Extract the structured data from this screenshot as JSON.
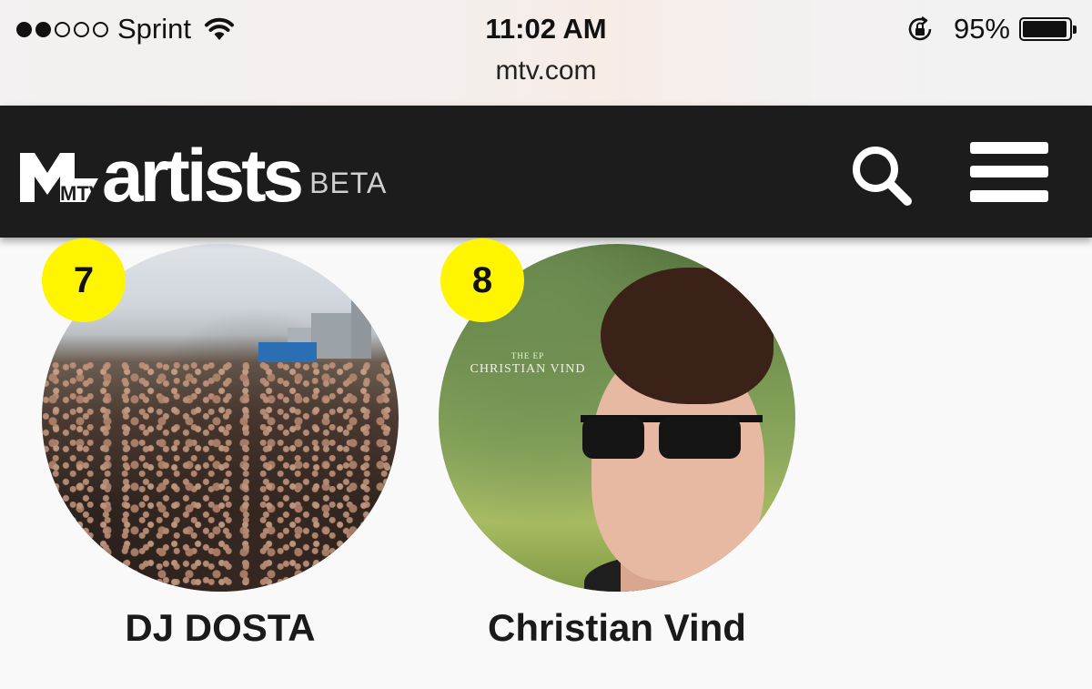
{
  "status_bar": {
    "carrier": "Sprint",
    "signal_strength": 2,
    "signal_max": 5,
    "time": "11:02 AM",
    "url": "mtv.com",
    "battery_percent_label": "95%",
    "battery_level": 0.95,
    "icons": [
      "wifi-icon",
      "rotation-lock-icon",
      "battery-icon"
    ]
  },
  "header": {
    "logo_mark": "MTV",
    "logo_word": "artists",
    "logo_badge": "BETA",
    "background": "#1c1c1c",
    "icons": [
      "search-icon",
      "hamburger-menu-icon"
    ]
  },
  "artists": [
    {
      "rank": "7",
      "name": "DJ DOSTA",
      "image": "concert crowd photo"
    },
    {
      "rank": "8",
      "name": "Christian Vind",
      "image": "portrait with sunglasses",
      "cover_small": "THE EP",
      "cover_title": "CHRISTIAN VIND"
    }
  ],
  "colors": {
    "rank_badge": "#fff500",
    "page_background": "#f9f9f9"
  }
}
